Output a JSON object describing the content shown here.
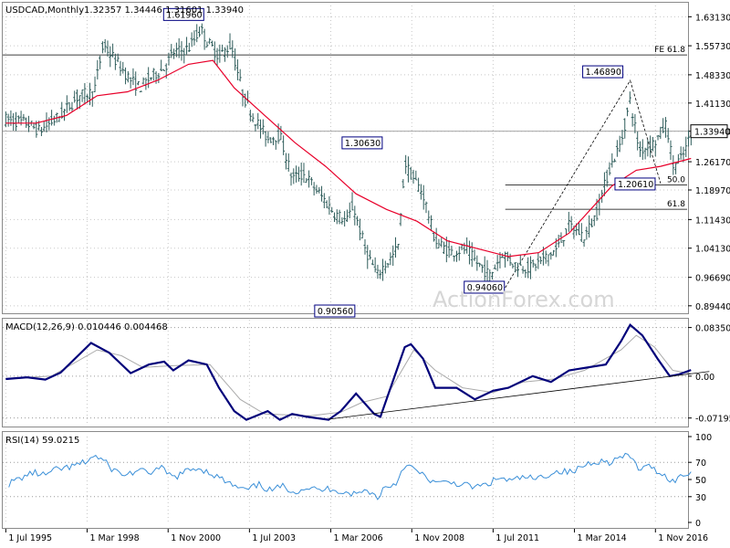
{
  "header": {
    "symbol": "USDCAD,Monthly",
    "ohlc": "1.32357 1.34446 1.31601 1.33940"
  },
  "colors": {
    "background": "#ffffff",
    "grid": "#c8c8c8",
    "bars": "#2f5d5b",
    "ma": "#e8002a",
    "macd": "#00007a",
    "signal": "#aaaaaa",
    "rsi": "#3a8fd8",
    "label_border": "#000080",
    "price_line": "#9a9a9a",
    "watermark": "#d6d6d6"
  },
  "watermark": "ActionForex.com",
  "chart_data": [
    {
      "type": "candlestick",
      "panel": "price",
      "ylim": [
        0.88,
        1.66
      ],
      "y_ticks": [
        "1.63130",
        "1.55730",
        "1.48330",
        "1.41130",
        "1.33940",
        "1.26170",
        "1.18970",
        "1.11430",
        "1.04130",
        "0.96690",
        "0.89440"
      ],
      "y_tick_values": [
        1.6313,
        1.5573,
        1.4833,
        1.4113,
        1.3394,
        1.2617,
        1.1897,
        1.1143,
        1.0413,
        0.9669,
        0.8944
      ],
      "x_ticks": [
        "1 Jul 1995",
        "1 Mar 1998",
        "1 Nov 2000",
        "1 Jul 2003",
        "1 Mar 2006",
        "1 Nov 2008",
        "1 Jul 2011",
        "1 Mar 2014",
        "1 Nov 2016"
      ],
      "x_tick_times": [
        1995.5,
        1998.17,
        2000.83,
        2003.5,
        2006.17,
        2008.83,
        2011.5,
        2014.17,
        2016.83
      ],
      "xlim": [
        1995.4,
        2017.9
      ],
      "price_path": [
        [
          1995.5,
          1.37
        ],
        [
          1996.2,
          1.36
        ],
        [
          1996.6,
          1.34
        ],
        [
          1997.3,
          1.38
        ],
        [
          1997.9,
          1.43
        ],
        [
          1998.4,
          1.44
        ],
        [
          1998.7,
          1.56
        ],
        [
          1999.0,
          1.53
        ],
        [
          1999.6,
          1.47
        ],
        [
          1999.9,
          1.45
        ],
        [
          2000.3,
          1.48
        ],
        [
          2000.7,
          1.5
        ],
        [
          2001.0,
          1.54
        ],
        [
          2001.5,
          1.55
        ],
        [
          2001.9,
          1.6
        ],
        [
          2002.1,
          1.57
        ],
        [
          2002.5,
          1.53
        ],
        [
          2002.9,
          1.56
        ],
        [
          2003.3,
          1.43
        ],
        [
          2003.6,
          1.38
        ],
        [
          2004.1,
          1.32
        ],
        [
          2004.5,
          1.33
        ],
        [
          2004.9,
          1.22
        ],
        [
          2005.3,
          1.23
        ],
        [
          2005.8,
          1.18
        ],
        [
          2006.3,
          1.13
        ],
        [
          2006.7,
          1.11
        ],
        [
          2006.9,
          1.15
        ],
        [
          2007.3,
          1.04
        ],
        [
          2007.7,
          0.97
        ],
        [
          2007.85,
          0.99
        ],
        [
          2008.2,
          1.02
        ],
        [
          2008.4,
          1.05
        ],
        [
          2008.6,
          1.26
        ],
        [
          2008.8,
          1.23
        ],
        [
          2009.2,
          1.18
        ],
        [
          2009.6,
          1.06
        ],
        [
          2010.1,
          1.03
        ],
        [
          2010.6,
          1.04
        ],
        [
          2010.9,
          1.01
        ],
        [
          2011.4,
          0.97
        ],
        [
          2011.8,
          1.03
        ],
        [
          2012.2,
          1.0
        ],
        [
          2012.7,
          0.99
        ],
        [
          2013.1,
          1.01
        ],
        [
          2013.6,
          1.04
        ],
        [
          2014.0,
          1.1
        ],
        [
          2014.5,
          1.07
        ],
        [
          2014.9,
          1.13
        ],
        [
          2015.3,
          1.24
        ],
        [
          2015.7,
          1.31
        ],
        [
          2016.0,
          1.42
        ],
        [
          2016.3,
          1.29
        ],
        [
          2016.8,
          1.31
        ],
        [
          2017.2,
          1.36
        ],
        [
          2017.4,
          1.25
        ],
        [
          2017.7,
          1.27
        ],
        [
          2017.9,
          1.31
        ],
        [
          2018.0,
          1.339
        ]
      ],
      "moving_average": [
        [
          1995.5,
          1.36
        ],
        [
          1996.5,
          1.36
        ],
        [
          1997.5,
          1.38
        ],
        [
          1998.5,
          1.43
        ],
        [
          1999.5,
          1.44
        ],
        [
          2000.5,
          1.47
        ],
        [
          2001.5,
          1.51
        ],
        [
          2002.3,
          1.52
        ],
        [
          2003.0,
          1.45
        ],
        [
          2004.0,
          1.38
        ],
        [
          2005.0,
          1.31
        ],
        [
          2006.0,
          1.25
        ],
        [
          2007.0,
          1.18
        ],
        [
          2008.0,
          1.14
        ],
        [
          2009.0,
          1.11
        ],
        [
          2010.0,
          1.06
        ],
        [
          2011.0,
          1.04
        ],
        [
          2012.0,
          1.02
        ],
        [
          2013.0,
          1.03
        ],
        [
          2014.0,
          1.08
        ],
        [
          2014.7,
          1.14
        ],
        [
          2015.4,
          1.2
        ],
        [
          2016.2,
          1.24
        ],
        [
          2017.0,
          1.25
        ],
        [
          2018.0,
          1.27
        ]
      ],
      "annotations": [
        {
          "label": "1.61960",
          "t": 2002.0,
          "v": 1.6196
        },
        {
          "label": "1.30630",
          "t": 2007.8,
          "v": 1.3063
        },
        {
          "label": "0.90560",
          "t": 2007.2,
          "v": 0.9056
        },
        {
          "label": "0.94060",
          "t": 2011.9,
          "v": 0.9406
        },
        {
          "label": "1.46890",
          "t": 2016.0,
          "v": 1.4689
        },
        {
          "label": "1.20610",
          "t": 2017.0,
          "v": 1.2061
        }
      ],
      "fib_levels": [
        {
          "label": "FE 61.8",
          "v": 1.534
        },
        {
          "label": "50.0",
          "v": 1.2025
        },
        {
          "label": "61.8",
          "v": 1.1405
        }
      ],
      "current_price": {
        "label": "1.33940",
        "v": 1.3394
      }
    },
    {
      "type": "line",
      "panel": "macd",
      "title": "MACD(12,26,9) 0.010446 0.004468",
      "y_ticks": [
        "0.083505",
        "0.00",
        "-0.07195"
      ],
      "y_tick_values": [
        0.083505,
        0.0,
        -0.07195
      ],
      "ylim": [
        -0.085,
        0.097
      ],
      "series": [
        {
          "name": "MACD",
          "points": [
            [
              1995.5,
              -0.005
            ],
            [
              1996.2,
              -0.002
            ],
            [
              1996.8,
              -0.006
            ],
            [
              1997.3,
              0.006
            ],
            [
              1998.3,
              0.057
            ],
            [
              1998.9,
              0.04
            ],
            [
              1999.6,
              0.005
            ],
            [
              2000.2,
              0.02
            ],
            [
              2000.7,
              0.025
            ],
            [
              2001.0,
              0.01
            ],
            [
              2001.5,
              0.027
            ],
            [
              2002.1,
              0.02
            ],
            [
              2002.5,
              -0.02
            ],
            [
              2003.0,
              -0.06
            ],
            [
              2003.4,
              -0.075
            ],
            [
              2004.1,
              -0.06
            ],
            [
              2004.5,
              -0.075
            ],
            [
              2004.9,
              -0.065
            ],
            [
              2005.4,
              -0.07
            ],
            [
              2006.1,
              -0.075
            ],
            [
              2006.5,
              -0.06
            ],
            [
              2007.0,
              -0.03
            ],
            [
              2007.6,
              -0.065
            ],
            [
              2007.8,
              -0.07
            ],
            [
              2008.6,
              0.05
            ],
            [
              2008.8,
              0.055
            ],
            [
              2009.2,
              0.03
            ],
            [
              2009.6,
              -0.02
            ],
            [
              2010.3,
              -0.02
            ],
            [
              2010.9,
              -0.04
            ],
            [
              2011.5,
              -0.025
            ],
            [
              2012.0,
              -0.02
            ],
            [
              2012.8,
              0.0
            ],
            [
              2013.4,
              -0.01
            ],
            [
              2014.0,
              0.01
            ],
            [
              2015.2,
              0.02
            ],
            [
              2015.7,
              0.06
            ],
            [
              2016.0,
              0.088
            ],
            [
              2016.4,
              0.07
            ],
            [
              2016.9,
              0.03
            ],
            [
              2017.3,
              0.0
            ],
            [
              2017.6,
              0.003
            ],
            [
              2018.0,
              0.0105
            ]
          ]
        },
        {
          "name": "Signal",
          "points": [
            [
              1995.5,
              -0.004
            ],
            [
              1997.0,
              0.0
            ],
            [
              1998.5,
              0.045
            ],
            [
              1999.3,
              0.035
            ],
            [
              2000.0,
              0.015
            ],
            [
              2001.0,
              0.018
            ],
            [
              2002.2,
              0.02
            ],
            [
              2003.2,
              -0.04
            ],
            [
              2004.0,
              -0.065
            ],
            [
              2005.5,
              -0.068
            ],
            [
              2006.5,
              -0.062
            ],
            [
              2007.2,
              -0.045
            ],
            [
              2008.0,
              -0.035
            ],
            [
              2008.9,
              0.045
            ],
            [
              2009.6,
              0.01
            ],
            [
              2010.5,
              -0.02
            ],
            [
              2011.5,
              -0.028
            ],
            [
              2012.5,
              -0.01
            ],
            [
              2013.5,
              -0.005
            ],
            [
              2014.5,
              0.01
            ],
            [
              2015.7,
              0.045
            ],
            [
              2016.2,
              0.07
            ],
            [
              2016.8,
              0.05
            ],
            [
              2017.4,
              0.01
            ],
            [
              2018.0,
              0.0045
            ]
          ]
        }
      ]
    },
    {
      "type": "line",
      "panel": "rsi",
      "title": "RSI(14) 59.0215",
      "y_ticks": [
        "100",
        "70",
        "50",
        "30",
        "0"
      ],
      "y_tick_values": [
        100,
        70,
        50,
        30,
        0
      ],
      "ylim": [
        0,
        100
      ],
      "series": [
        {
          "name": "RSI",
          "points": [
            [
              1995.6,
              45
            ],
            [
              1996.0,
              52
            ],
            [
              1996.4,
              58
            ],
            [
              1996.8,
              55
            ],
            [
              1997.2,
              62
            ],
            [
              1997.6,
              64
            ],
            [
              1998.1,
              70
            ],
            [
              1998.4,
              78
            ],
            [
              1998.7,
              72
            ],
            [
              1999.0,
              62
            ],
            [
              1999.4,
              55
            ],
            [
              1999.8,
              60
            ],
            [
              2000.2,
              58
            ],
            [
              2000.6,
              63
            ],
            [
              2001.0,
              52
            ],
            [
              2001.4,
              59
            ],
            [
              2001.8,
              64
            ],
            [
              2002.2,
              58
            ],
            [
              2002.6,
              50
            ],
            [
              2003.0,
              42
            ],
            [
              2003.4,
              37
            ],
            [
              2003.8,
              44
            ],
            [
              2004.2,
              37
            ],
            [
              2004.6,
              42
            ],
            [
              2005.0,
              36
            ],
            [
              2005.4,
              41
            ],
            [
              2005.8,
              37
            ],
            [
              2006.2,
              40
            ],
            [
              2006.6,
              35
            ],
            [
              2007.0,
              33
            ],
            [
              2007.4,
              38
            ],
            [
              2007.7,
              28
            ],
            [
              2007.9,
              40
            ],
            [
              2008.3,
              45
            ],
            [
              2008.6,
              68
            ],
            [
              2008.9,
              62
            ],
            [
              2009.3,
              52
            ],
            [
              2009.7,
              45
            ],
            [
              2010.1,
              47
            ],
            [
              2010.5,
              44
            ],
            [
              2010.9,
              41
            ],
            [
              2011.3,
              44
            ],
            [
              2011.7,
              52
            ],
            [
              2012.1,
              48
            ],
            [
              2012.5,
              53
            ],
            [
              2012.9,
              50
            ],
            [
              2013.3,
              56
            ],
            [
              2013.7,
              60
            ],
            [
              2014.1,
              58
            ],
            [
              2014.5,
              67
            ],
            [
              2014.9,
              72
            ],
            [
              2015.3,
              70
            ],
            [
              2015.7,
              76
            ],
            [
              2016.0,
              77
            ],
            [
              2016.3,
              62
            ],
            [
              2016.7,
              65
            ],
            [
              2017.1,
              55
            ],
            [
              2017.4,
              48
            ],
            [
              2017.7,
              54
            ],
            [
              2018.0,
              59
            ]
          ]
        }
      ]
    }
  ]
}
